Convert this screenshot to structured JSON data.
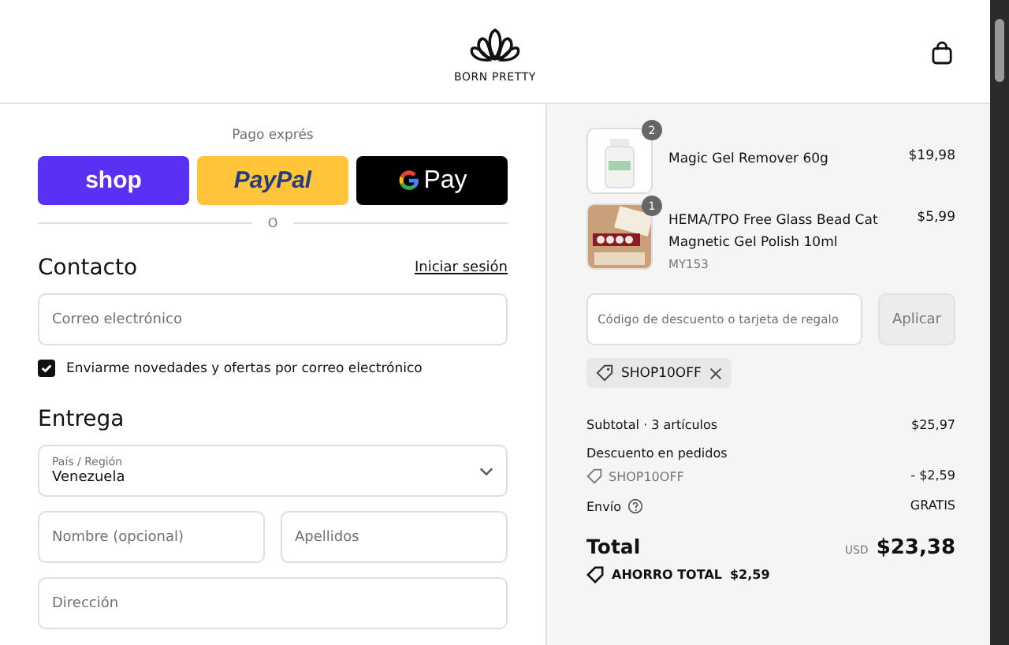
{
  "header": {
    "brand": "BORN PRETTY"
  },
  "express": {
    "title": "Pago exprés",
    "buttons": [
      {
        "kind": "shop",
        "label": "shop"
      },
      {
        "kind": "paypal",
        "label": "PayPal"
      },
      {
        "kind": "gpay",
        "label": "Pay"
      }
    ],
    "divider": "O"
  },
  "contact": {
    "title": "Contacto",
    "login_link": "Iniciar sesión",
    "email": {
      "placeholder": "Correo electrónico"
    },
    "newsletter": {
      "label": "Enviarme novedades y ofertas por correo electrónico",
      "checked": true
    }
  },
  "delivery": {
    "title": "Entrega",
    "country": {
      "label": "País / Región",
      "value": "Venezuela"
    },
    "first_name": {
      "placeholder": "Nombre (opcional)"
    },
    "last_name": {
      "placeholder": "Apellidos"
    },
    "address": {
      "placeholder": "Dirección"
    }
  },
  "summary": {
    "items": [
      {
        "kind": "bottle",
        "quantity": "2",
        "name": "Magic Gel Remover 60g",
        "price": "$19,98"
      },
      {
        "kind": "polish",
        "quantity": "1",
        "name": "HEMA/TPO Free Glass Bead Cat Magnetic Gel Polish 10ml",
        "variant": "MY153",
        "price": "$5,99"
      }
    ],
    "discount": {
      "placeholder": "Código de descuento o tarjeta de regalo",
      "button": "Aplicar",
      "applied_code": "SHOP10OFF"
    },
    "subtotal": {
      "label": "Subtotal · 3 artículos",
      "value": "$25,97"
    },
    "order_discount": {
      "label": "Descuento en pedidos",
      "code": "SHOP10OFF",
      "value": "- $2,59"
    },
    "shipping": {
      "label": "Envío",
      "value": "GRATIS"
    },
    "total": {
      "label": "Total",
      "currency": "USD",
      "value": "$23,38"
    },
    "savings": {
      "label": "AHORRO TOTAL",
      "value": "$2,59"
    }
  }
}
